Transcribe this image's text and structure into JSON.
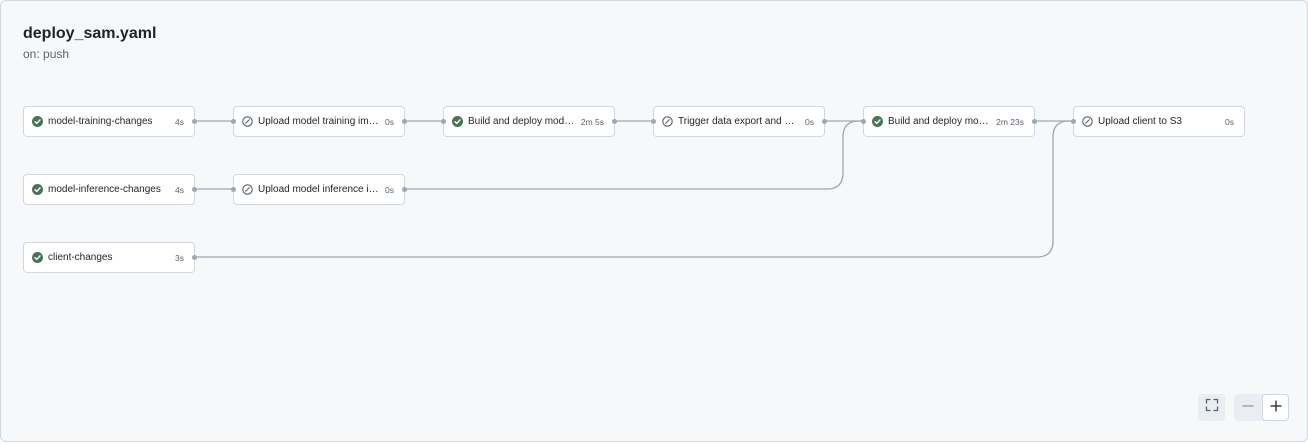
{
  "workflow": {
    "title": "deploy_sam.yaml",
    "trigger": "on: push"
  },
  "jobs": [
    {
      "id": "model-training-changes",
      "name": "model-training-changes",
      "duration": "4s",
      "status": "success"
    },
    {
      "id": "upload-model-training-image",
      "name": "Upload model training ima…",
      "duration": "0s",
      "status": "skipped"
    },
    {
      "id": "build-deploy-model-1",
      "name": "Build and deploy model …",
      "duration": "2m 5s",
      "status": "success"
    },
    {
      "id": "trigger-data-export",
      "name": "Trigger data export and mo…",
      "duration": "0s",
      "status": "skipped"
    },
    {
      "id": "build-deploy-model-2",
      "name": "Build and deploy mode…",
      "duration": "2m 23s",
      "status": "success"
    },
    {
      "id": "upload-client-s3",
      "name": "Upload client to S3",
      "duration": "0s",
      "status": "skipped"
    },
    {
      "id": "model-inference-changes",
      "name": "model-inference-changes",
      "duration": "4s",
      "status": "success"
    },
    {
      "id": "upload-model-inference-image",
      "name": "Upload model inference im…",
      "duration": "0s",
      "status": "skipped"
    },
    {
      "id": "client-changes",
      "name": "client-changes",
      "duration": "3s",
      "status": "success"
    }
  ],
  "controls": {
    "fullscreen_icon": "fullscreen-icon",
    "zoom_out_icon": "minus-icon",
    "zoom_in_icon": "plus-icon"
  },
  "colors": {
    "success": "#1f883d",
    "success_dark": "#4a7357",
    "skipped": "#59636e",
    "connector": "#9ea7b3",
    "canvas_bg": "#f6f8fa",
    "border": "#d0d7de"
  }
}
